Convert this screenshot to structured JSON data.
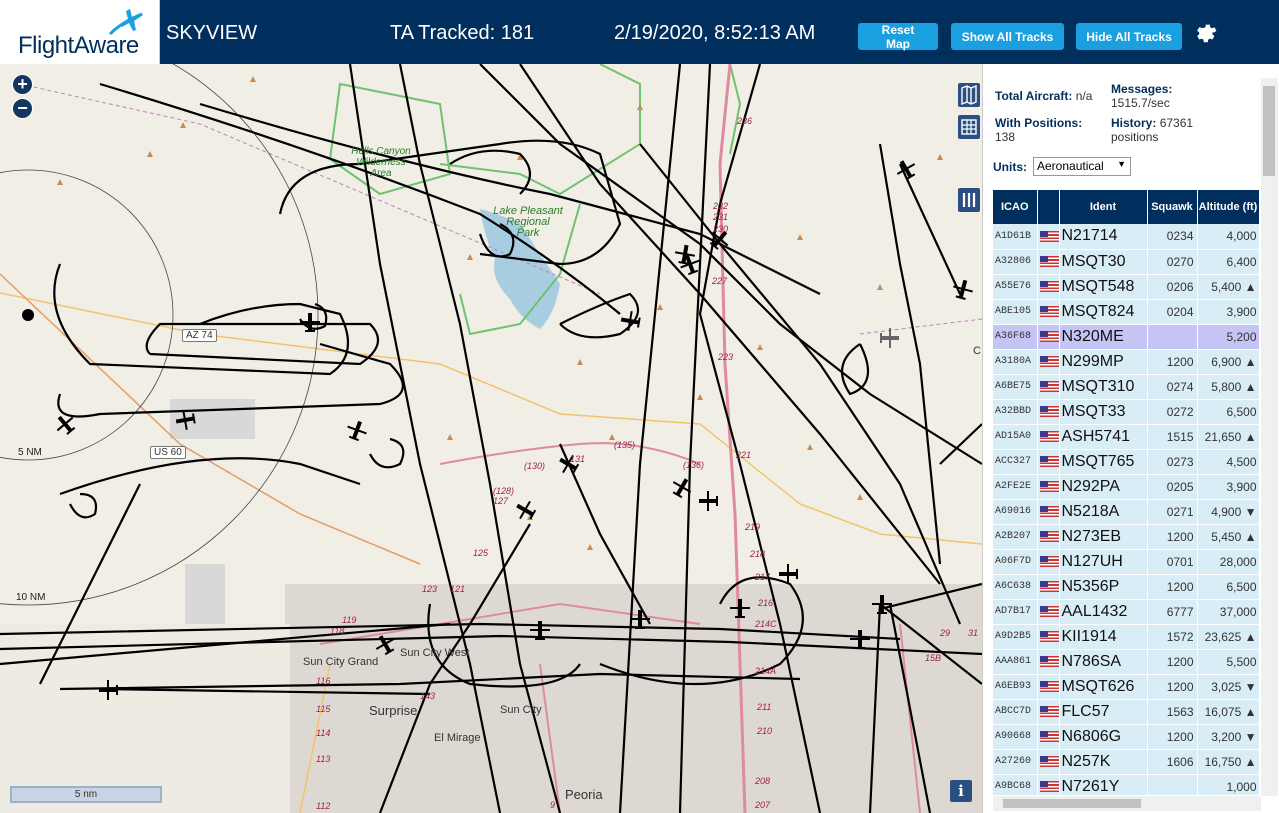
{
  "header": {
    "logo": "FlightAware",
    "app_name": "SKYVIEW",
    "tracked": "TA Tracked: 181",
    "datetime": "2/19/2020, 8:52:13 AM",
    "reset_map": "Reset Map",
    "show_all_tracks": "Show All Tracks",
    "hide_all_tracks": "Hide All Tracks"
  },
  "map": {
    "parks": [
      "Hells Canyon",
      "Wilderness",
      "Area",
      "Lake Pleasant",
      "Regional",
      "Park"
    ],
    "cities": [
      "Sun City Grand",
      "Sun City West",
      "Surprise",
      "Sun City",
      "El Mirage",
      "Peoria"
    ],
    "roads": [
      "AZ 74",
      "US 60"
    ],
    "range_rings": [
      "5 NM",
      "10 NM"
    ],
    "road_numbers": [
      "236",
      "232",
      "231",
      "230",
      "227",
      "223",
      "221",
      "219",
      "218",
      "217",
      "216",
      "214C",
      "214A",
      "211",
      "210",
      "208",
      "207",
      "(135)",
      "(136)",
      "(130)",
      "(128)",
      "131",
      "127",
      "125",
      "123",
      "121",
      "119",
      "118",
      "116",
      "115",
      "114",
      "113",
      "112",
      "143",
      "9",
      "15B",
      "29",
      "31",
      "C"
    ],
    "scale": "5 nm",
    "info": "i"
  },
  "panel": {
    "total_aircraft_label": "Total Aircraft:",
    "total_aircraft_value": "n/a",
    "messages_label": "Messages:",
    "messages_value": "1515.7/sec",
    "with_positions_label": "With Positions:",
    "with_positions_value": "138",
    "history_label": "History:",
    "history_value": "67361",
    "history_unit": "positions",
    "units_label": "Units:",
    "units_value": "Aeronautical",
    "columns": [
      "ICAO",
      "",
      "Ident",
      "Squawk",
      "Altitude (ft)"
    ],
    "rows": [
      {
        "icao": "A1D61B",
        "ident": "N21714",
        "squawk": "0234",
        "alt": "4,000"
      },
      {
        "icao": "A32806",
        "ident": "MSQT30",
        "squawk": "0270",
        "alt": "6,400"
      },
      {
        "icao": "A55E76",
        "ident": "MSQT548",
        "squawk": "0206",
        "alt": "5,400 ▲"
      },
      {
        "icao": "ABE105",
        "ident": "MSQT824",
        "squawk": "0204",
        "alt": "3,900"
      },
      {
        "icao": "A36F68",
        "ident": "N320ME",
        "squawk": "",
        "alt": "5,200"
      },
      {
        "icao": "A3180A",
        "ident": "N299MP",
        "squawk": "1200",
        "alt": "6,900 ▲"
      },
      {
        "icao": "A6BE75",
        "ident": "MSQT310",
        "squawk": "0274",
        "alt": "5,800 ▲"
      },
      {
        "icao": "A32BBD",
        "ident": "MSQT33",
        "squawk": "0272",
        "alt": "6,500"
      },
      {
        "icao": "AD15A0",
        "ident": "ASH5741",
        "squawk": "1515",
        "alt": "21,650 ▲"
      },
      {
        "icao": "ACC327",
        "ident": "MSQT765",
        "squawk": "0273",
        "alt": "4,500"
      },
      {
        "icao": "A2FE2E",
        "ident": "N292PA",
        "squawk": "0205",
        "alt": "3,900"
      },
      {
        "icao": "A69016",
        "ident": "N5218A",
        "squawk": "0271",
        "alt": "4,900 ▼"
      },
      {
        "icao": "A2B207",
        "ident": "N273EB",
        "squawk": "1200",
        "alt": "5,450 ▲"
      },
      {
        "icao": "A06F7D",
        "ident": "N127UH",
        "squawk": "0701",
        "alt": "28,000"
      },
      {
        "icao": "A6C638",
        "ident": "N5356P",
        "squawk": "1200",
        "alt": "6,500"
      },
      {
        "icao": "AD7B17",
        "ident": "AAL1432",
        "squawk": "6777",
        "alt": "37,000"
      },
      {
        "icao": "A9D2B5",
        "ident": "KII1914",
        "squawk": "1572",
        "alt": "23,625 ▲"
      },
      {
        "icao": "AAA861",
        "ident": "N786SA",
        "squawk": "1200",
        "alt": "5,500"
      },
      {
        "icao": "A6EB93",
        "ident": "MSQT626",
        "squawk": "1200",
        "alt": "3,025 ▼"
      },
      {
        "icao": "ABCC7D",
        "ident": "FLC57",
        "squawk": "1563",
        "alt": "16,075 ▲"
      },
      {
        "icao": "A90668",
        "ident": "N6806G",
        "squawk": "1200",
        "alt": "3,200 ▼"
      },
      {
        "icao": "A27260",
        "ident": "N257K",
        "squawk": "1606",
        "alt": "16,750 ▲"
      },
      {
        "icao": "A9BC68",
        "ident": "N7261Y",
        "squawk": "",
        "alt": "1,000"
      }
    ]
  },
  "colors": {
    "header_bg": "#002f5d",
    "button_bg": "#1a9fe0",
    "row_bg": "#d9edf7",
    "selected_row_bg": "#c5c5f5",
    "track_color": "#000000"
  }
}
